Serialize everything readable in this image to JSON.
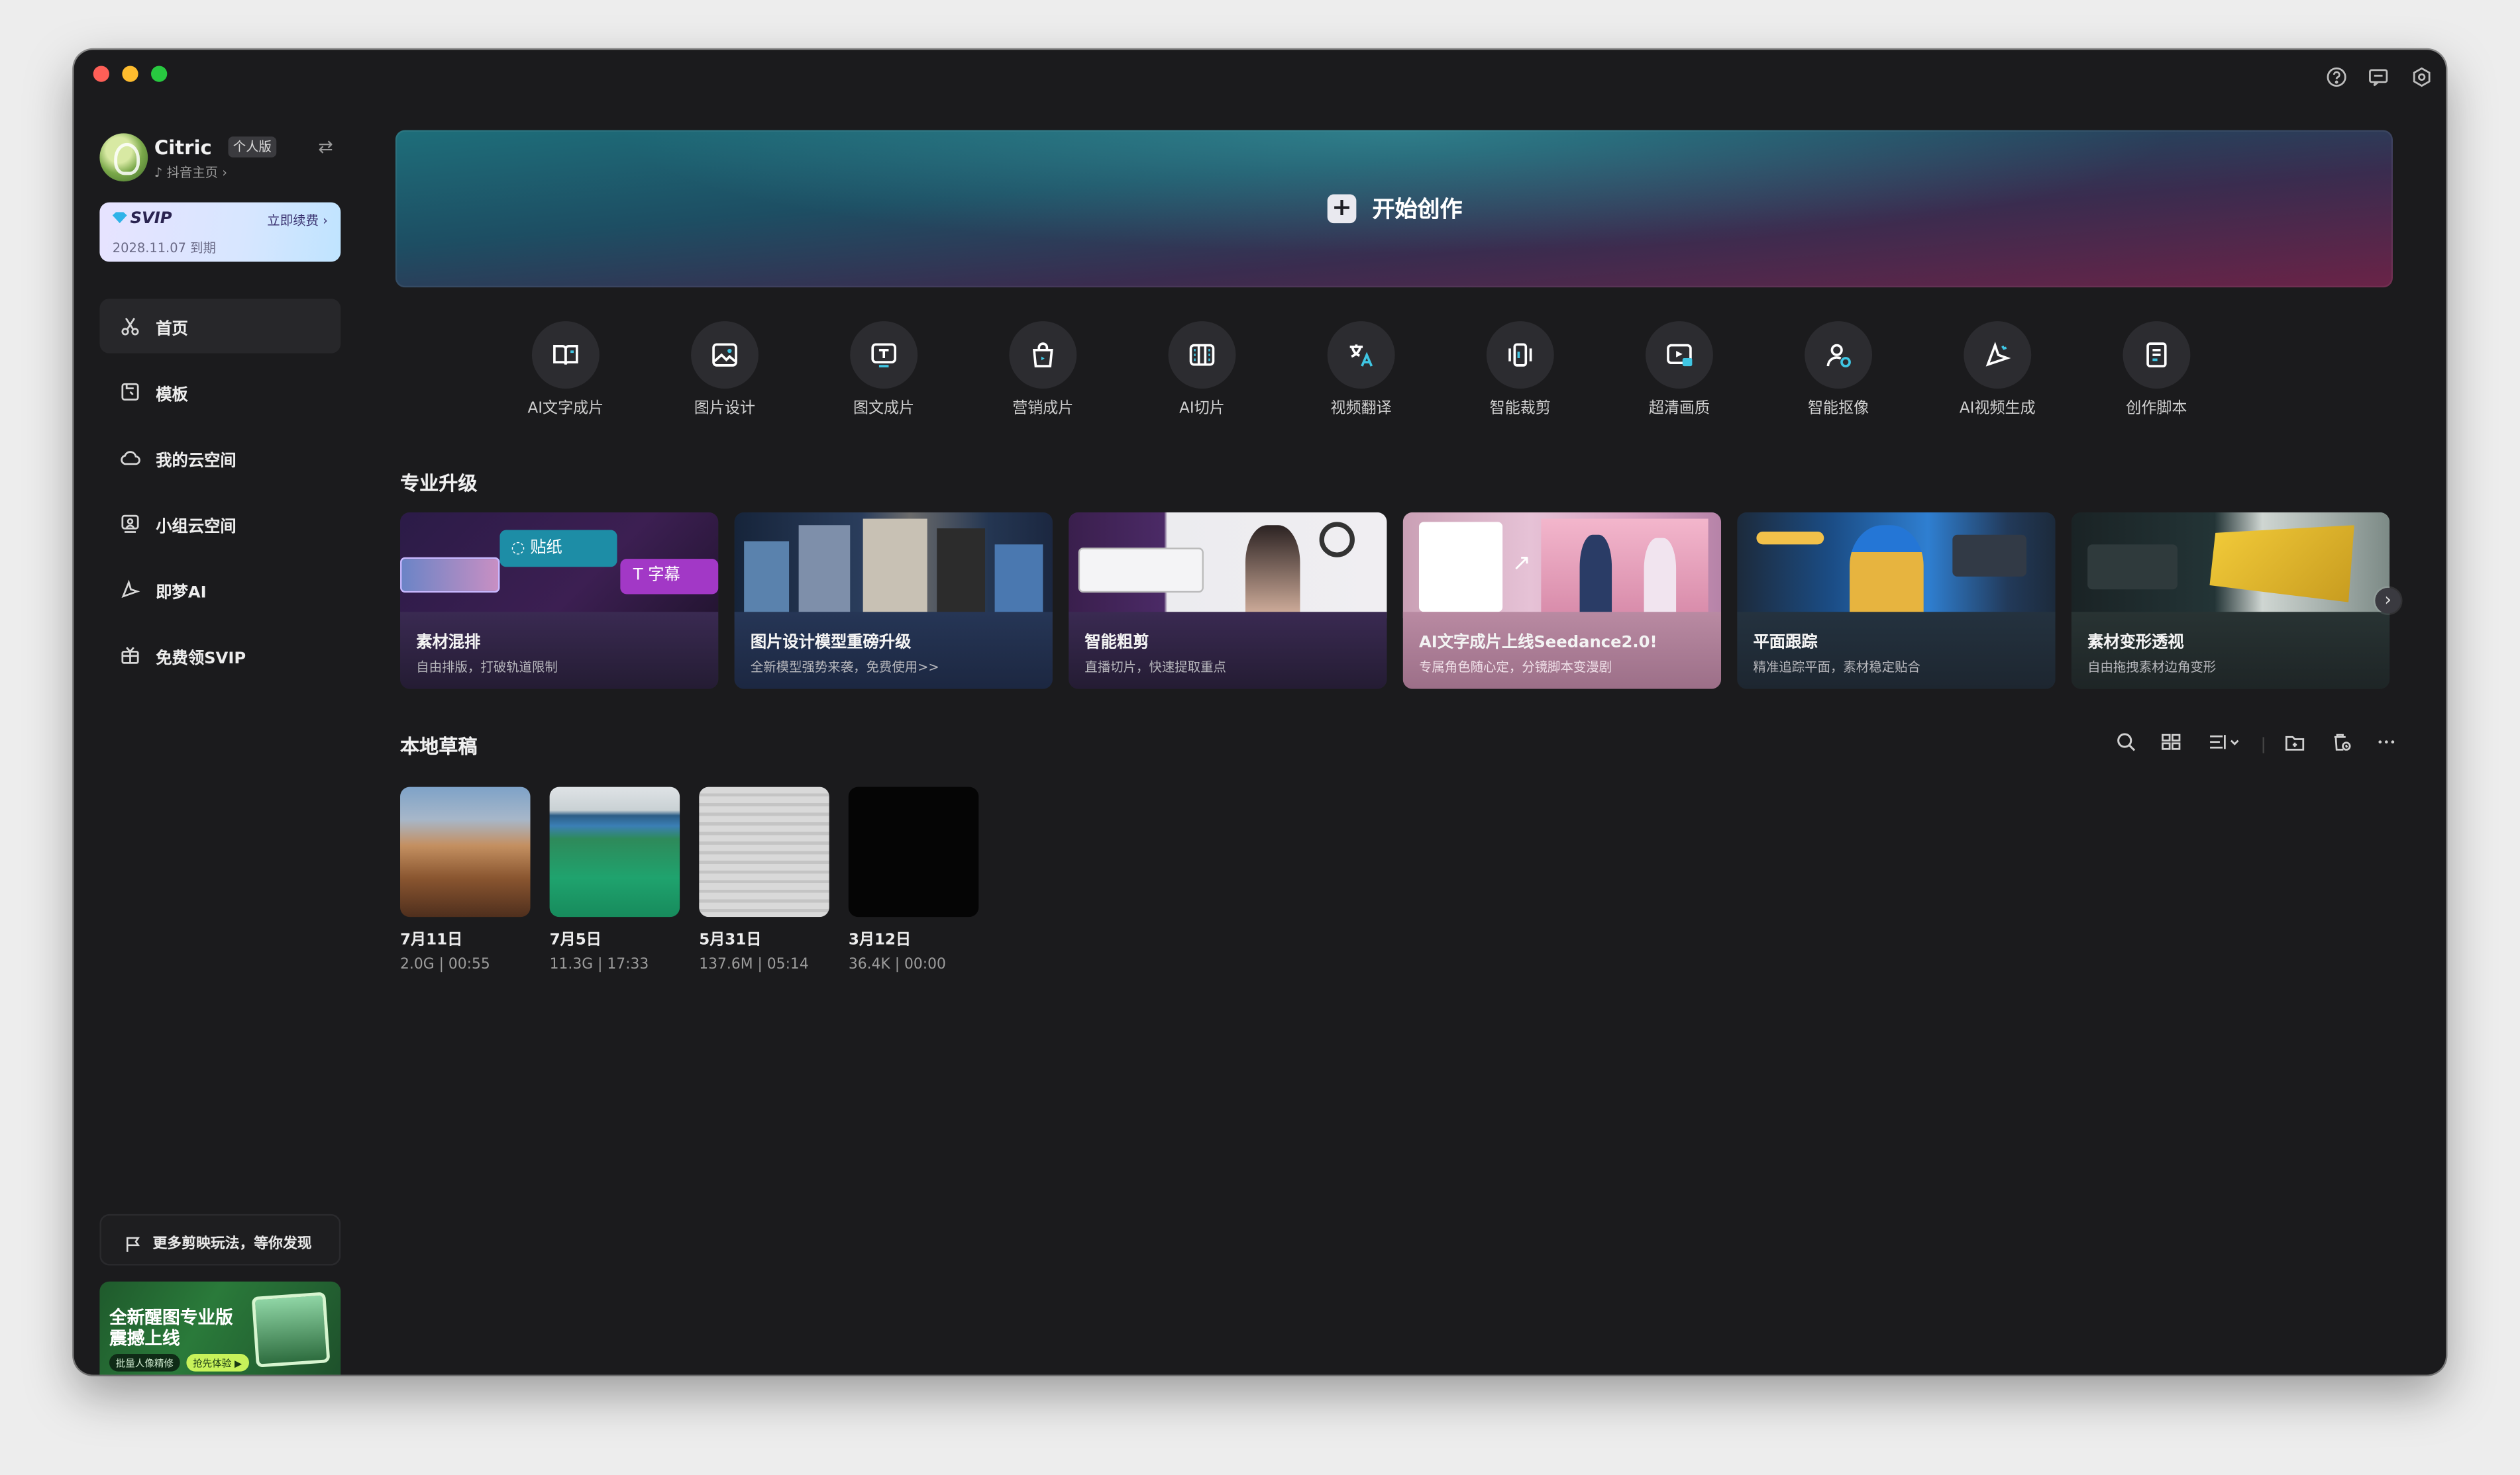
{
  "user": {
    "name": "Citric",
    "badge": "个人版",
    "profile_link": "抖音主页 ›"
  },
  "svip": {
    "title": "SVIP",
    "renew": "立即续费 ›",
    "expiry": "2028.11.07 到期"
  },
  "nav": [
    {
      "label": "首页",
      "icon": "scissors-icon",
      "active": true
    },
    {
      "label": "模板",
      "icon": "template-icon"
    },
    {
      "label": "我的云空间",
      "icon": "cloud-icon"
    },
    {
      "label": "小组云空间",
      "icon": "team-cloud-icon"
    },
    {
      "label": "即梦AI",
      "icon": "dreamina-icon"
    },
    {
      "label": "免费领SVIP",
      "icon": "gift-icon"
    }
  ],
  "discover": {
    "label": "更多剪映玩法，等你发现"
  },
  "promo": {
    "line1": "全新醒图专业版",
    "line2": "震撼上线",
    "pill1": "批量人像精修",
    "pill2": "抢先体验 ▶"
  },
  "hero": {
    "label": "开始创作"
  },
  "tools": [
    {
      "label": "AI文字成片",
      "icon": "ai-text-video-icon"
    },
    {
      "label": "图片设计",
      "icon": "image-design-icon"
    },
    {
      "label": "图文成片",
      "icon": "text-image-video-icon"
    },
    {
      "label": "营销成片",
      "icon": "shopping-bag-icon"
    },
    {
      "label": "AI切片",
      "icon": "ai-slice-icon"
    },
    {
      "label": "视频翻译",
      "icon": "translate-icon"
    },
    {
      "label": "智能裁剪",
      "icon": "smart-crop-icon"
    },
    {
      "label": "超清画质",
      "icon": "hd-quality-icon"
    },
    {
      "label": "智能抠像",
      "icon": "smart-cutout-icon"
    },
    {
      "label": "AI视频生成",
      "icon": "ai-video-gen-icon"
    },
    {
      "label": "创作脚本",
      "icon": "script-icon"
    }
  ],
  "pro_section": {
    "title": "专业升级"
  },
  "pro_cards": [
    {
      "title": "素材混排",
      "subtitle": "自由排版，打破轨道限制",
      "thumb_labels": [
        "贴纸",
        "T 字幕"
      ]
    },
    {
      "title": "图片设计模型重磅升级",
      "subtitle": "全新模型强势来袭，免费使用>>"
    },
    {
      "title": "智能粗剪",
      "subtitle": "直播切片，快速提取重点"
    },
    {
      "title": "AI文字成片上线Seedance2.0!",
      "subtitle": "专属角色随心定，分镜脚本变漫剧"
    },
    {
      "title": "平面跟踪",
      "subtitle": "精准追踪平面，素材稳定贴合"
    },
    {
      "title": "素材变形透视",
      "subtitle": "自由拖拽素材边角变形"
    }
  ],
  "drafts_section": {
    "title": "本地草稿"
  },
  "drafts": [
    {
      "date": "7月11日",
      "meta": "2.0G | 00:55"
    },
    {
      "date": "7月5日",
      "meta": "11.3G | 17:33"
    },
    {
      "date": "5月31日",
      "meta": "137.6M | 05:14"
    },
    {
      "date": "3月12日",
      "meta": "36.4K | 00:00"
    }
  ],
  "colors": {
    "window_bg": "#1b1b1d",
    "accent_svip": "#d7e6ff",
    "traffic_red": "#fe5f57",
    "traffic_yellow": "#febc2e",
    "traffic_green": "#28c840"
  }
}
